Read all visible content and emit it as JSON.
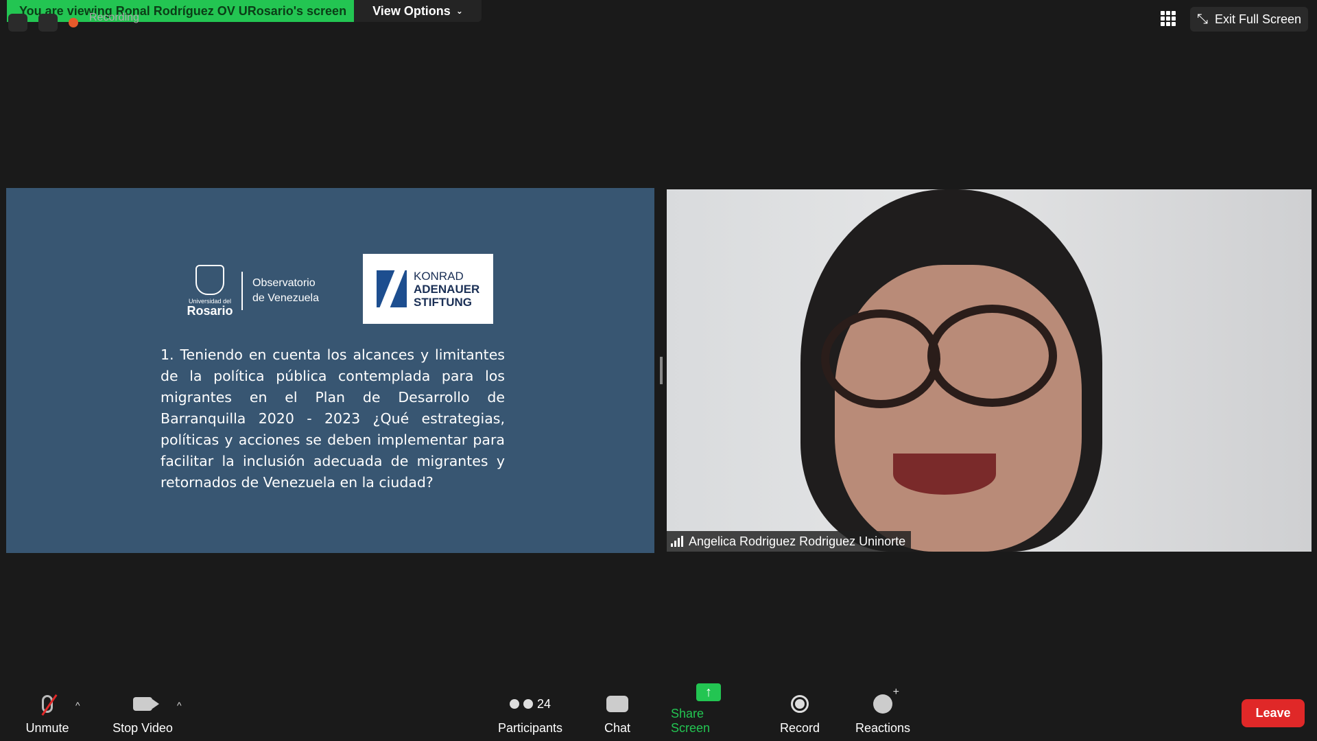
{
  "banner": {
    "viewing_text": "You are viewing Ronal Rodríguez OV URosario's screen",
    "view_options_label": "View Options"
  },
  "top_right": {
    "exit_full_screen_label": "Exit Full Screen"
  },
  "recording": {
    "label": "Recording"
  },
  "slide": {
    "rosario_small": "Universidad del",
    "rosario_big": "Rosario",
    "observatorio_line1": "Observatorio",
    "observatorio_line2": "de Venezuela",
    "konrad_line1": "KONRAD",
    "konrad_line2": "ADENAUER",
    "konrad_line3": "STIFTUNG",
    "question": "1. Teniendo en cuenta los alcances y limitantes de la política pública contemplada para los migrantes en el Plan de Desarrollo de Barranquilla 2020 - 2023 ¿Qué estrategias, políticas y acciones se deben implementar para facilitar la inclusión adecuada de migrantes y retornados de Venezuela en la ciudad?"
  },
  "video": {
    "participant_name": "Angelica Rodriguez Rodriguez Uninorte"
  },
  "toolbar": {
    "unmute_label": "Unmute",
    "stop_video_label": "Stop Video",
    "participants_label": "Participants",
    "participants_count": "24",
    "chat_label": "Chat",
    "share_screen_label": "Share Screen",
    "record_label": "Record",
    "reactions_label": "Reactions",
    "leave_label": "Leave"
  },
  "colors": {
    "banner_green": "#23c552",
    "slide_blue": "#385672",
    "leave_red": "#e02828"
  }
}
